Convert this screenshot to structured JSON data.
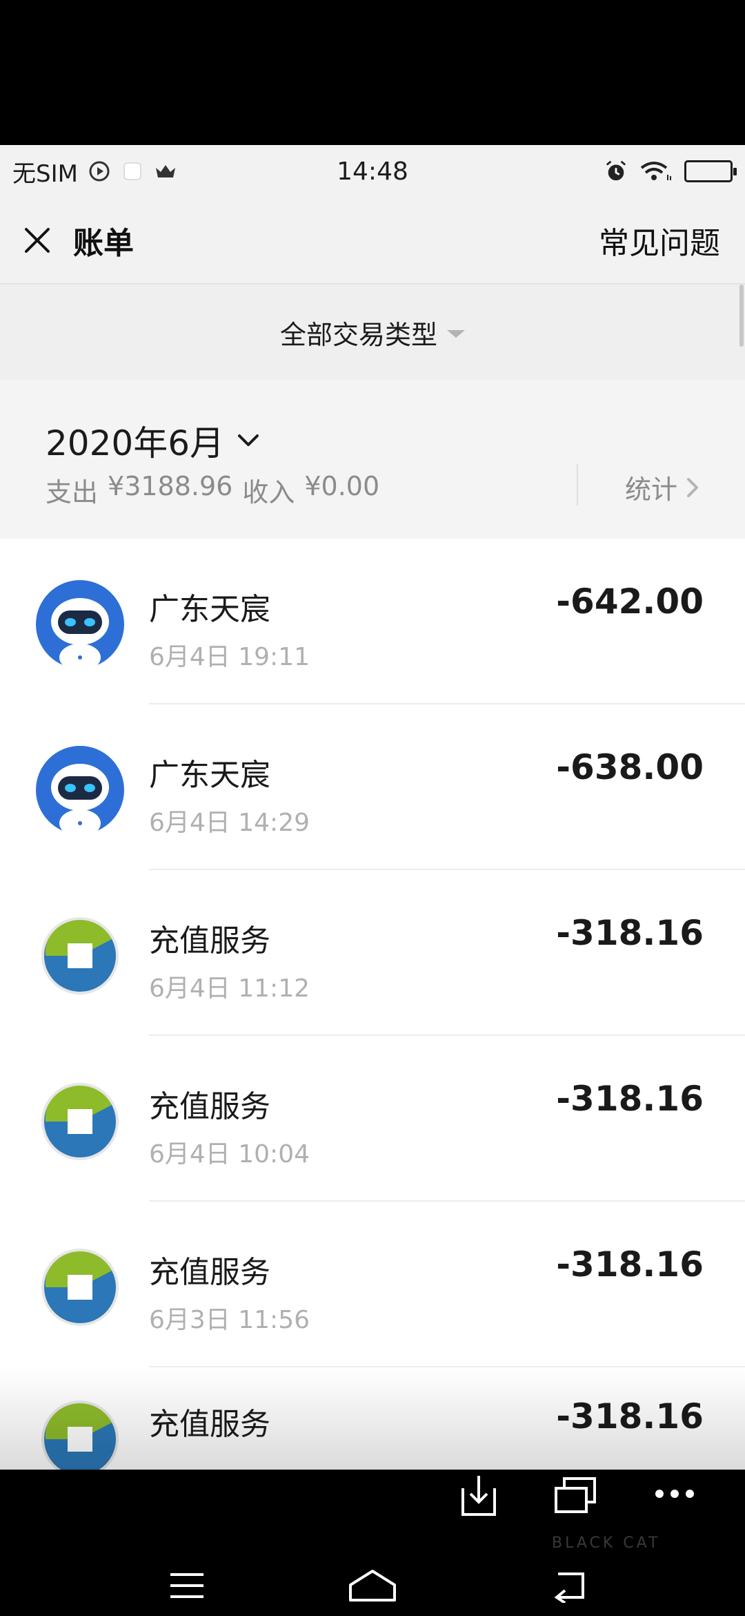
{
  "status_bar": {
    "carrier": "无SIM",
    "time": "14:48"
  },
  "header": {
    "title": "账单",
    "faq_label": "常见问题"
  },
  "filter": {
    "label": "全部交易类型"
  },
  "month": {
    "label": "2020年6月",
    "expense_label": "支出",
    "expense_value": "¥3188.96",
    "income_label": "收入",
    "income_value": "¥0.00",
    "stats_label": "统计"
  },
  "transactions": [
    {
      "name": "广东天宸",
      "time": "6月4日 19:11",
      "amount": "-642.00",
      "icon": "robot-avatar-icon"
    },
    {
      "name": "广东天宸",
      "time": "6月4日 14:29",
      "amount": "-638.00",
      "icon": "robot-avatar-icon"
    },
    {
      "name": "充值服务",
      "time": "6月4日 11:12",
      "amount": "-318.16",
      "icon": "recharge-service-icon"
    },
    {
      "name": "充值服务",
      "time": "6月4日 10:04",
      "amount": "-318.16",
      "icon": "recharge-service-icon"
    },
    {
      "name": "充值服务",
      "time": "6月3日 11:56",
      "amount": "-318.16",
      "icon": "recharge-service-icon"
    },
    {
      "name": "充值服务",
      "time": "",
      "amount": "-318.16",
      "icon": "recharge-service-icon"
    }
  ],
  "watermark": "BLACK CAT",
  "colors": {
    "page_bg": "#f4f4f4",
    "list_bg": "#ffffff",
    "primary_text": "#1a1a1a",
    "secondary_text": "#b0b0b0",
    "robot_blue": "#2d6fd6",
    "recharge_green": "#8dbb2a",
    "recharge_blue": "#2b77b7"
  }
}
